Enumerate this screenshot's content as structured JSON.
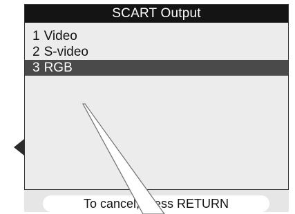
{
  "menu": {
    "title": "SCART Output",
    "items": [
      {
        "number": "1",
        "label": "Video",
        "selected": false
      },
      {
        "number": "2",
        "label": "S-video",
        "selected": false
      },
      {
        "number": "3",
        "label": "RGB",
        "selected": true
      }
    ]
  },
  "status": {
    "text": "To cancel, press RETURN"
  },
  "nav": {
    "left_arrow_icon": "triangle-left-icon"
  },
  "colors": {
    "title_bar": "#141414",
    "selection": "#4a4a4a",
    "menu_background": "#ececec"
  }
}
